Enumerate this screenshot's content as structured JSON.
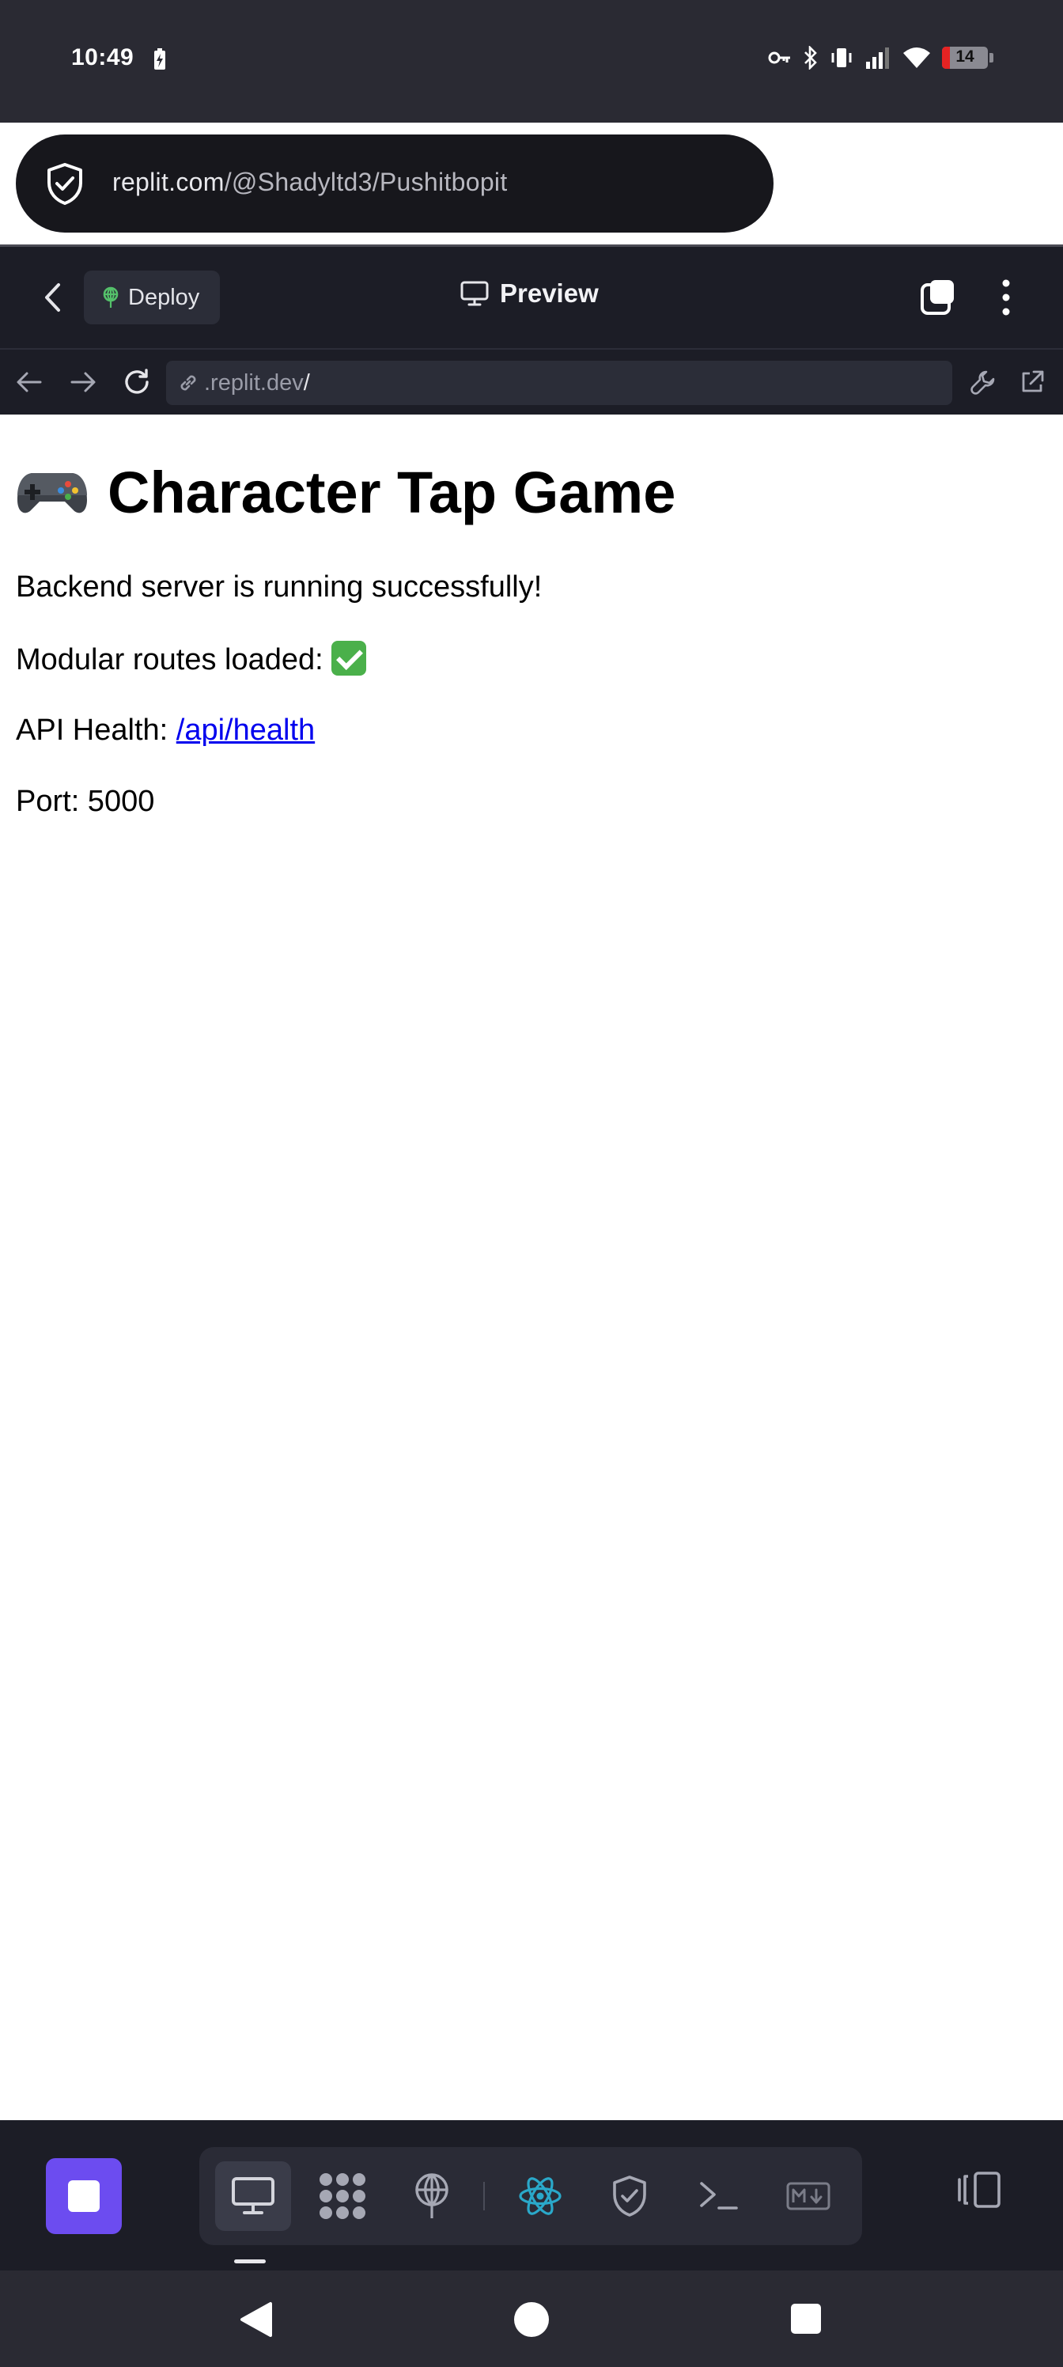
{
  "status_bar": {
    "time": "10:49",
    "battery_level": "14",
    "icons": [
      "battery-charging-icon",
      "vpn-key-icon",
      "bluetooth-icon",
      "vibrate-icon",
      "signal-icon",
      "wifi-icon",
      "battery-icon"
    ]
  },
  "browser": {
    "url_host": "replit.com",
    "url_path": "/@Shadyltd3/Pushitbopit",
    "tab_count": "1",
    "icons": [
      "shield-check-icon",
      "plus-icon",
      "tabs-icon",
      "more-vertical-icon"
    ]
  },
  "replit_header": {
    "deploy_label": "Deploy",
    "preview_label": "Preview",
    "icons": [
      "chevron-left-icon",
      "deploy-icon",
      "monitor-icon",
      "new-tab-icon",
      "more-vertical-icon"
    ]
  },
  "preview_nav": {
    "url_text": ".replit.dev",
    "url_slash": "/",
    "icons": [
      "arrow-left-icon",
      "arrow-right-icon",
      "refresh-icon",
      "link-icon",
      "wrench-icon",
      "external-link-icon"
    ]
  },
  "page": {
    "title": "Character Tap Game",
    "status_line": "Backend server is running successfully!",
    "routes_line": "Modular routes loaded:",
    "health_label": "API Health:",
    "health_link": "/api/health",
    "port_line": "Port: 5000"
  },
  "toolbar": {
    "icons": [
      "stop-icon",
      "preview-monitor-icon",
      "apps-grid-icon",
      "deploy-icon",
      "react-icon",
      "security-shield-icon",
      "terminal-icon",
      "markdown-icon",
      "split-layout-icon"
    ],
    "colors": {
      "stop_button": "#6c4cf0",
      "react_icon": "#2aa8c9"
    }
  }
}
